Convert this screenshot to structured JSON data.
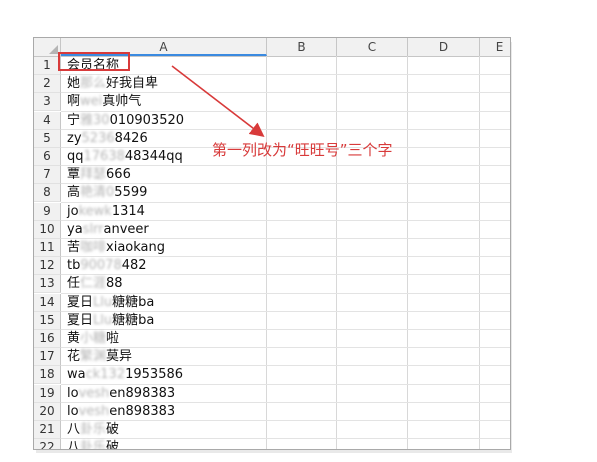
{
  "sheet": {
    "columns": [
      "A",
      "B",
      "C",
      "D",
      "E"
    ],
    "rows": [
      {
        "num": "1",
        "text": "会员名称"
      },
      {
        "num": "2",
        "pre": "她",
        "mask": "那么",
        "post": "好我自卑"
      },
      {
        "num": "3",
        "pre": "啊",
        "mask": "wei",
        "post": "真帅气"
      },
      {
        "num": "4",
        "pre": "宁",
        "mask": "雅30",
        "post": "010903520"
      },
      {
        "num": "5",
        "pre": "zy",
        "mask": "5236",
        "post": "8426"
      },
      {
        "num": "6",
        "pre": "qq",
        "mask": "17638",
        "post": "48344qq"
      },
      {
        "num": "7",
        "pre": "覃",
        "mask": "拜瑟",
        "post": "666"
      },
      {
        "num": "8",
        "pre": "高",
        "mask": "艳清0",
        "post": "5599"
      },
      {
        "num": "9",
        "pre": "jo",
        "mask": "kewk",
        "post": "1314"
      },
      {
        "num": "10",
        "pre": "ya",
        "mask": "slrr",
        "post": "anveer"
      },
      {
        "num": "11",
        "pre": "苦",
        "mask": "咖啡",
        "post": "xiaokang"
      },
      {
        "num": "12",
        "pre": "tb",
        "mask": "90078",
        "post": "482"
      },
      {
        "num": "13",
        "pre": "任",
        "mask": "仁涯",
        "post": "88"
      },
      {
        "num": "14",
        "pre": "夏日",
        "mask": "Llu",
        "post": "糖糖ba"
      },
      {
        "num": "15",
        "pre": "夏日",
        "mask": "Llu",
        "post": "糖糖ba"
      },
      {
        "num": "16",
        "pre": "黄",
        "mask": "小糖",
        "post": "啦"
      },
      {
        "num": "17",
        "pre": "花",
        "mask": "繁渊",
        "post": "莫异"
      },
      {
        "num": "18",
        "pre": "wa",
        "mask": "ck132",
        "post": "1953586"
      },
      {
        "num": "19",
        "pre": "lo",
        "mask": "vesh",
        "post": "en898383"
      },
      {
        "num": "20",
        "pre": "lo",
        "mask": "vesh",
        "post": "en898383"
      },
      {
        "num": "21",
        "pre": "八",
        "mask": "卦乐",
        "post": "破"
      },
      {
        "num": "22",
        "pre": "八",
        "mask": "卦乐",
        "post": "破"
      }
    ]
  },
  "annotation": {
    "text": "第一列改为“旺旺号”三个字",
    "color": "#d83a3a"
  }
}
